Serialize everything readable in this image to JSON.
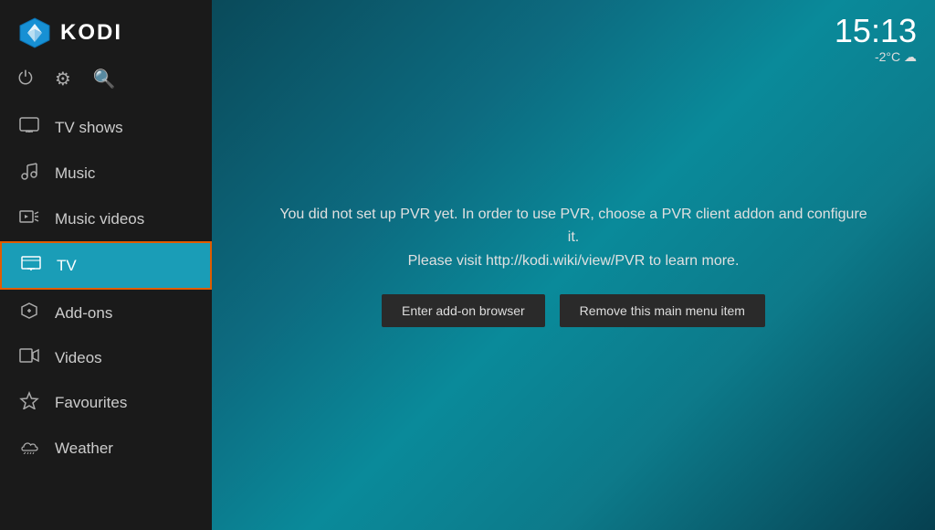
{
  "app": {
    "title": "KODI"
  },
  "clock": {
    "time": "15:13",
    "weather": "-2°C ☁"
  },
  "toolbar": {
    "icons": [
      "power",
      "settings",
      "search"
    ]
  },
  "sidebar": {
    "items": [
      {
        "id": "tv-shows",
        "label": "TV shows",
        "icon": "tv"
      },
      {
        "id": "music",
        "label": "Music",
        "icon": "music"
      },
      {
        "id": "music-videos",
        "label": "Music videos",
        "icon": "music-video"
      },
      {
        "id": "tv",
        "label": "TV",
        "icon": "tv-live",
        "active": true
      },
      {
        "id": "add-ons",
        "label": "Add-ons",
        "icon": "addon"
      },
      {
        "id": "videos",
        "label": "Videos",
        "icon": "video"
      },
      {
        "id": "favourites",
        "label": "Favourites",
        "icon": "star"
      },
      {
        "id": "weather",
        "label": "Weather",
        "icon": "weather"
      }
    ]
  },
  "pvr": {
    "message": "You did not set up PVR yet. In order to use PVR, choose a PVR client addon and configure it.\nPlease visit http://kodi.wiki/view/PVR to learn more.",
    "message_line1": "You did not set up PVR yet. In order to use PVR, choose a PVR client addon and configure it.",
    "message_line2": "Please visit http://kodi.wiki/view/PVR to learn more.",
    "btn_addon": "Enter add-on browser",
    "btn_remove": "Remove this main menu item"
  }
}
